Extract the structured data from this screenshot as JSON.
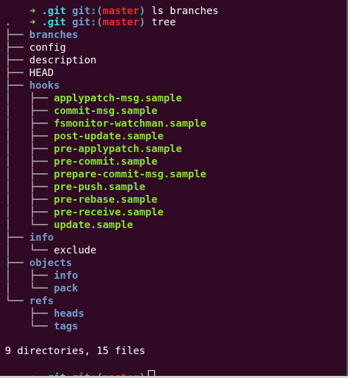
{
  "top_partial": {
    "arrow": "➜",
    "dir": ".git",
    "git_label": "git:(",
    "branch": "master",
    "git_close": ")",
    "cmd": "ls branches"
  },
  "prompt": {
    "arrow": "➜",
    "dir": ".git",
    "git_label": "git:(",
    "branch": "master",
    "git_close": ")",
    "command": "tree"
  },
  "tree": {
    "root": ".",
    "entries": [
      {
        "prefix": "├── ",
        "name": "branches",
        "kind": "dir"
      },
      {
        "prefix": "├── ",
        "name": "config",
        "kind": "file"
      },
      {
        "prefix": "├── ",
        "name": "description",
        "kind": "file"
      },
      {
        "prefix": "├── ",
        "name": "HEAD",
        "kind": "file"
      },
      {
        "prefix": "├── ",
        "name": "hooks",
        "kind": "dir"
      },
      {
        "prefix": "│   ├── ",
        "name": "applypatch-msg.sample",
        "kind": "exec"
      },
      {
        "prefix": "│   ├── ",
        "name": "commit-msg.sample",
        "kind": "exec"
      },
      {
        "prefix": "│   ├── ",
        "name": "fsmonitor-watchman.sample",
        "kind": "exec"
      },
      {
        "prefix": "│   ├── ",
        "name": "post-update.sample",
        "kind": "exec"
      },
      {
        "prefix": "│   ├── ",
        "name": "pre-applypatch.sample",
        "kind": "exec"
      },
      {
        "prefix": "│   ├── ",
        "name": "pre-commit.sample",
        "kind": "exec"
      },
      {
        "prefix": "│   ├── ",
        "name": "prepare-commit-msg.sample",
        "kind": "exec"
      },
      {
        "prefix": "│   ├── ",
        "name": "pre-push.sample",
        "kind": "exec"
      },
      {
        "prefix": "│   ├── ",
        "name": "pre-rebase.sample",
        "kind": "exec"
      },
      {
        "prefix": "│   ├── ",
        "name": "pre-receive.sample",
        "kind": "exec"
      },
      {
        "prefix": "│   └── ",
        "name": "update.sample",
        "kind": "exec"
      },
      {
        "prefix": "├── ",
        "name": "info",
        "kind": "dir"
      },
      {
        "prefix": "│   └── ",
        "name": "exclude",
        "kind": "file"
      },
      {
        "prefix": "├── ",
        "name": "objects",
        "kind": "dir"
      },
      {
        "prefix": "│   ├── ",
        "name": "info",
        "kind": "dir"
      },
      {
        "prefix": "│   └── ",
        "name": "pack",
        "kind": "dir"
      },
      {
        "prefix": "└── ",
        "name": "refs",
        "kind": "dir"
      },
      {
        "prefix": "    ├── ",
        "name": "heads",
        "kind": "dir"
      },
      {
        "prefix": "    └── ",
        "name": "tags",
        "kind": "dir"
      }
    ]
  },
  "summary": "9 directories, 15 files",
  "colors": {
    "background": "#300a24",
    "dir": "#729fcf",
    "exec": "#8ae234",
    "branch": "#ef2929",
    "prompt_dir": "#34e2e2"
  }
}
